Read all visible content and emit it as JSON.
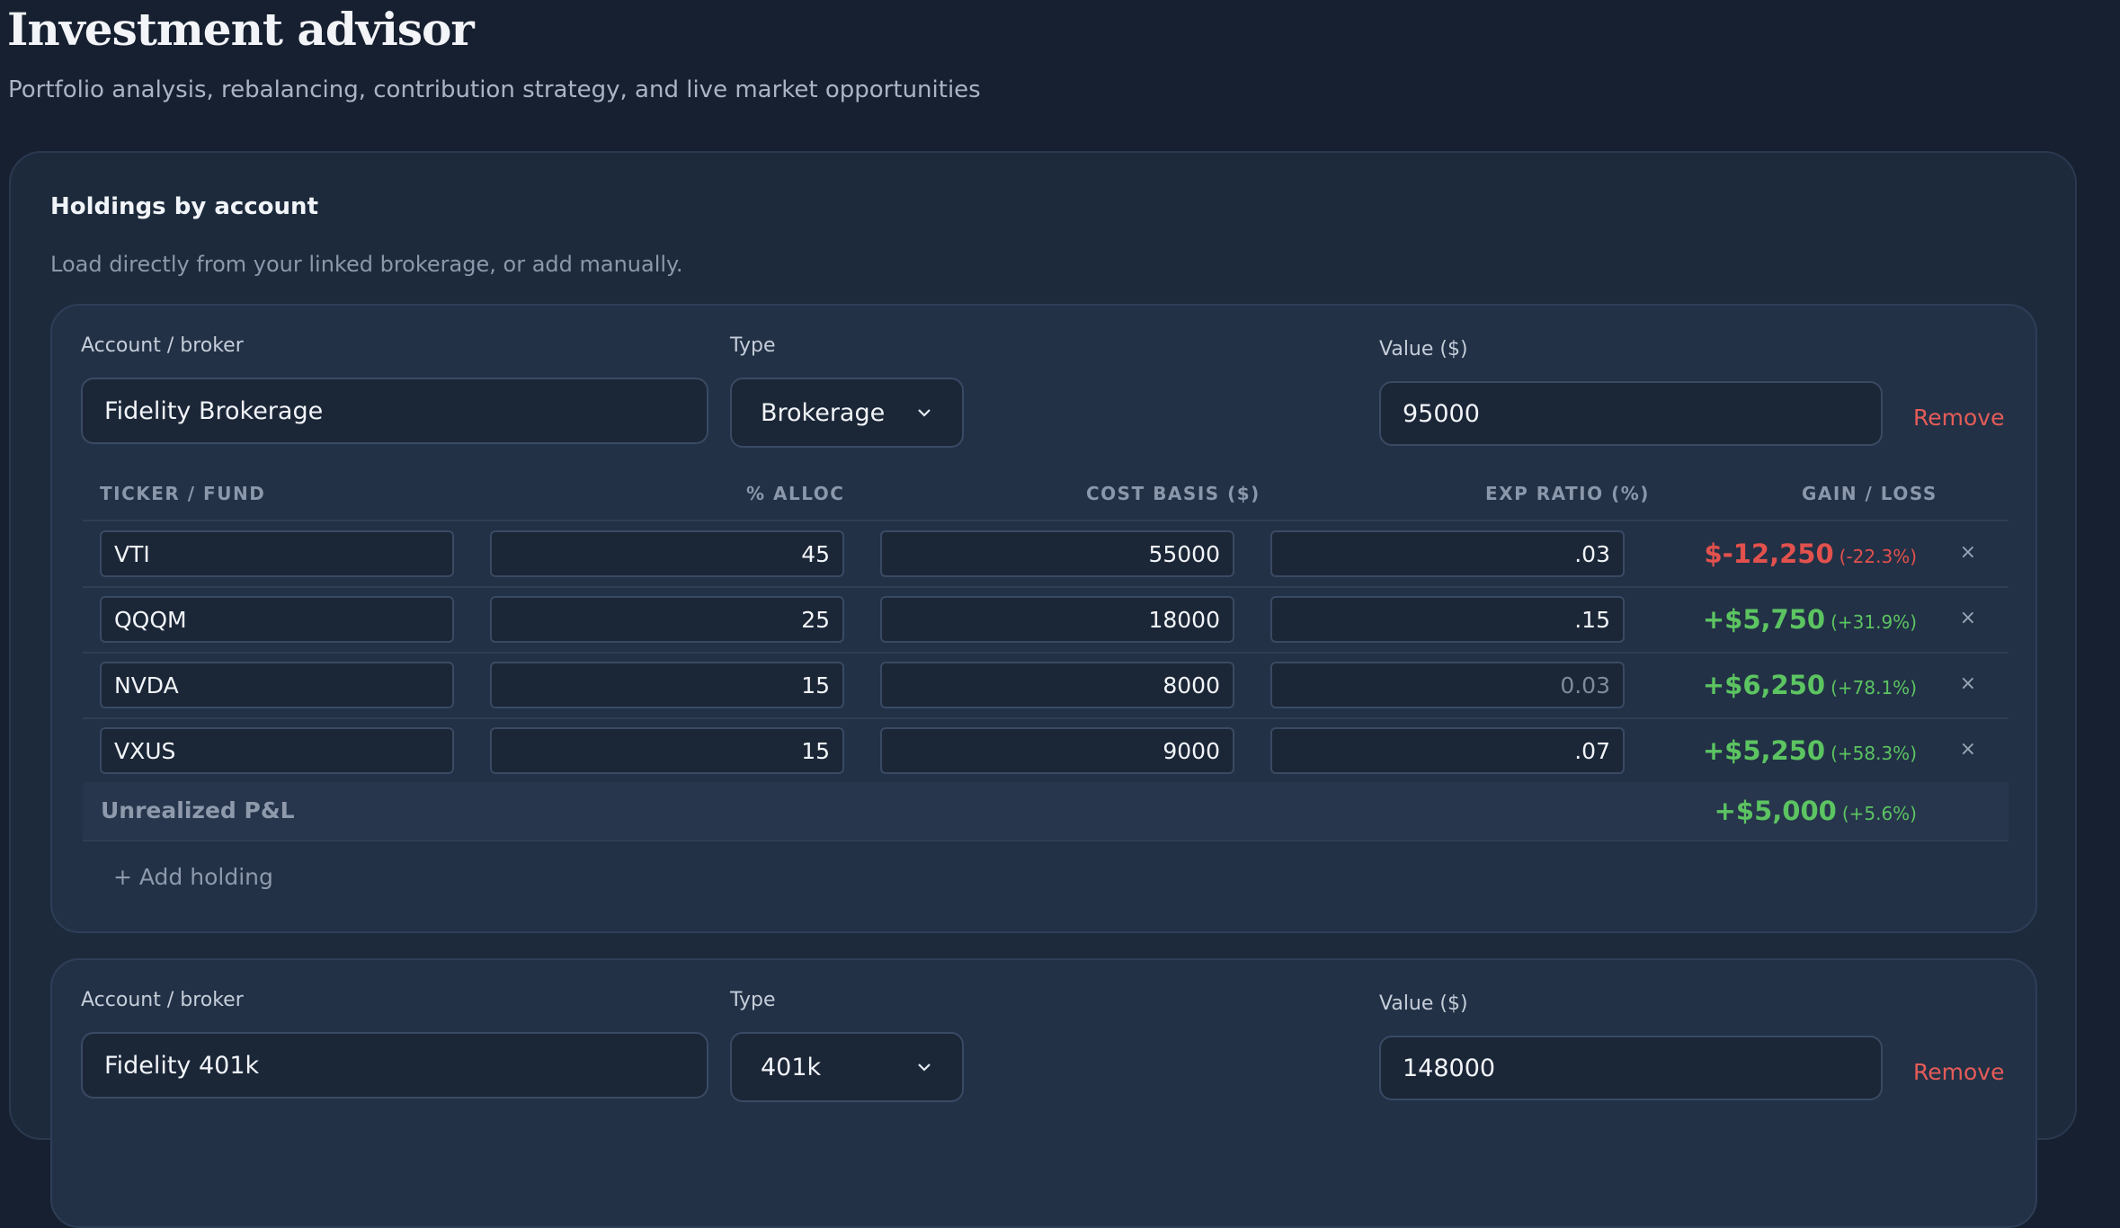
{
  "page": {
    "title": "Investment advisor",
    "subtitle": "Portfolio analysis, rebalancing, contribution strategy, and live market opportunities"
  },
  "holdings_panel": {
    "title": "Holdings by account",
    "description": "Load directly from your linked brokerage, or add manually."
  },
  "labels": {
    "account": "Account / broker",
    "type": "Type",
    "value": "Value ($)",
    "remove": "Remove",
    "add_holding": "+ Add holding",
    "unrealized": "Unrealized P&L",
    "remove_row": "×"
  },
  "columns": [
    "TICKER / FUND",
    "% ALLOC",
    "COST BASIS ($)",
    "EXP RATIO (%)",
    "GAIN / LOSS"
  ],
  "accounts": [
    {
      "name": "Fidelity Brokerage",
      "type": "Brokerage",
      "value": "95000",
      "holdings": [
        {
          "ticker": "VTI",
          "alloc": "45",
          "cost": "55000",
          "exp": ".03",
          "exp_placeholder": "",
          "gain": "$-12,250",
          "pct": "(-22.3%)",
          "status": "negative"
        },
        {
          "ticker": "QQQM",
          "alloc": "25",
          "cost": "18000",
          "exp": ".15",
          "exp_placeholder": "",
          "gain": "+$5,750",
          "pct": "(+31.9%)",
          "status": "positive"
        },
        {
          "ticker": "NVDA",
          "alloc": "15",
          "cost": "8000",
          "exp": "",
          "exp_placeholder": "0.03",
          "gain": "+$6,250",
          "pct": "(+78.1%)",
          "status": "positive"
        },
        {
          "ticker": "VXUS",
          "alloc": "15",
          "cost": "9000",
          "exp": ".07",
          "exp_placeholder": "",
          "gain": "+$5,250",
          "pct": "(+58.3%)",
          "status": "positive"
        }
      ],
      "unrealized": {
        "gain": "+$5,000",
        "pct": "(+5.6%)",
        "status": "positive"
      }
    },
    {
      "name": "Fidelity 401k",
      "type": "401k",
      "value": "148000"
    }
  ],
  "icons": {
    "select_chevron": "chevron-down-icon",
    "row_remove": "close-icon"
  },
  "colors": {
    "background": "#172030",
    "panel": "#1d2a3c",
    "card": "#223146",
    "positive": "#5cc461",
    "negative": "#e2514d",
    "remove_link": "#e55c58"
  }
}
